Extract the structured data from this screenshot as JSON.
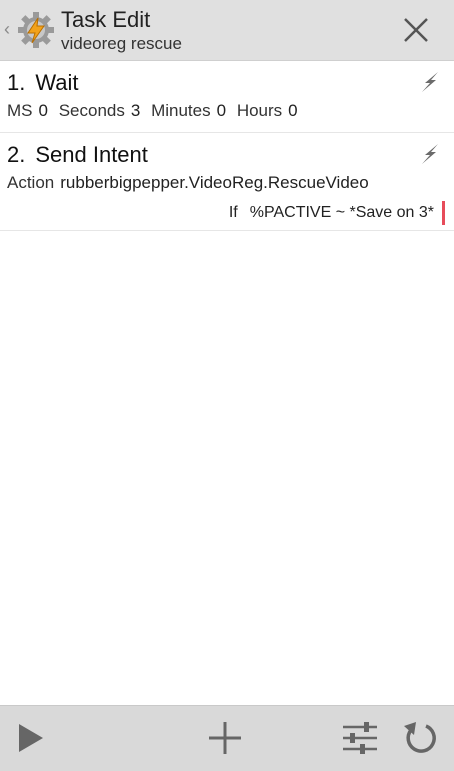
{
  "header": {
    "title": "Task Edit",
    "subtitle": "videoreg rescue",
    "back_glyph": "‹",
    "icons": [
      "chevron-left-icon",
      "tasker-gear-icon",
      "close-icon"
    ]
  },
  "actions": [
    {
      "number": "1.",
      "name": "Wait",
      "params": [
        {
          "label": "MS",
          "value": "0"
        },
        {
          "label": "Seconds",
          "value": "3"
        },
        {
          "label": "Minutes",
          "value": "0"
        },
        {
          "label": "Hours",
          "value": "0"
        }
      ],
      "icon": "lightning-icon"
    },
    {
      "number": "2.",
      "name": "Send Intent",
      "params": [
        {
          "label": "Action",
          "value": "rubberbigpepper.VideoReg.RescueVideo"
        }
      ],
      "condition": {
        "keyword": "If",
        "text": "%PACTIVE ~ *Save on 3*"
      },
      "icon": "lightning-icon"
    }
  ],
  "toolbar": {
    "icons": [
      "play-icon",
      "add-icon",
      "settings-sliders-icon",
      "undo-icon"
    ]
  },
  "colors": {
    "header_bg": "#e0e0e0",
    "toolbar_bg": "#d9d9d9",
    "condition_bar": "#e74c5a",
    "icon_gray": "#6b6b6b"
  }
}
